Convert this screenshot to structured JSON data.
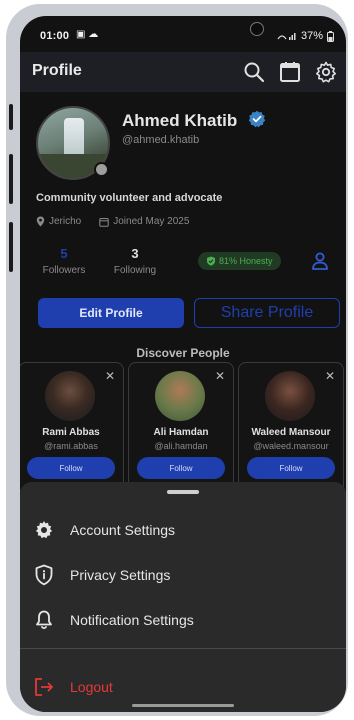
{
  "status_bar": {
    "time": "01:00",
    "battery": "37%"
  },
  "app_bar": {
    "title": "Profile"
  },
  "profile": {
    "name": "Ahmed Khatib",
    "handle": "@ahmed.khatib",
    "bio": "Community volunteer and advocate",
    "location": "Jericho",
    "joined": "Joined May 2025",
    "stats": {
      "followers_count": "5",
      "followers_label": "Followers",
      "following_count": "3",
      "following_label": "Following"
    },
    "honesty": "81% Honesty"
  },
  "actions": {
    "edit_label": "Edit Profile",
    "share_label": "Share Profile"
  },
  "discover": {
    "title": "Discover People",
    "people": [
      {
        "name": "Rami Abbas",
        "handle": "@rami.abbas",
        "follow": "Follow"
      },
      {
        "name": "Ali Hamdan",
        "handle": "@ali.hamdan",
        "follow": "Follow"
      },
      {
        "name": "Waleed Mansour",
        "handle": "@waleed.mansour",
        "follow": "Follow"
      }
    ]
  },
  "sheet": {
    "items": [
      {
        "label": "Account Settings",
        "icon": "gear-icon"
      },
      {
        "label": "Privacy Settings",
        "icon": "shield-info-icon"
      },
      {
        "label": "Notification Settings",
        "icon": "bell-icon"
      }
    ],
    "logout": "Logout"
  },
  "colors": {
    "accent": "#1f3fae",
    "danger": "#e53935",
    "success": "#4caf50",
    "verified": "#3b82c4"
  }
}
